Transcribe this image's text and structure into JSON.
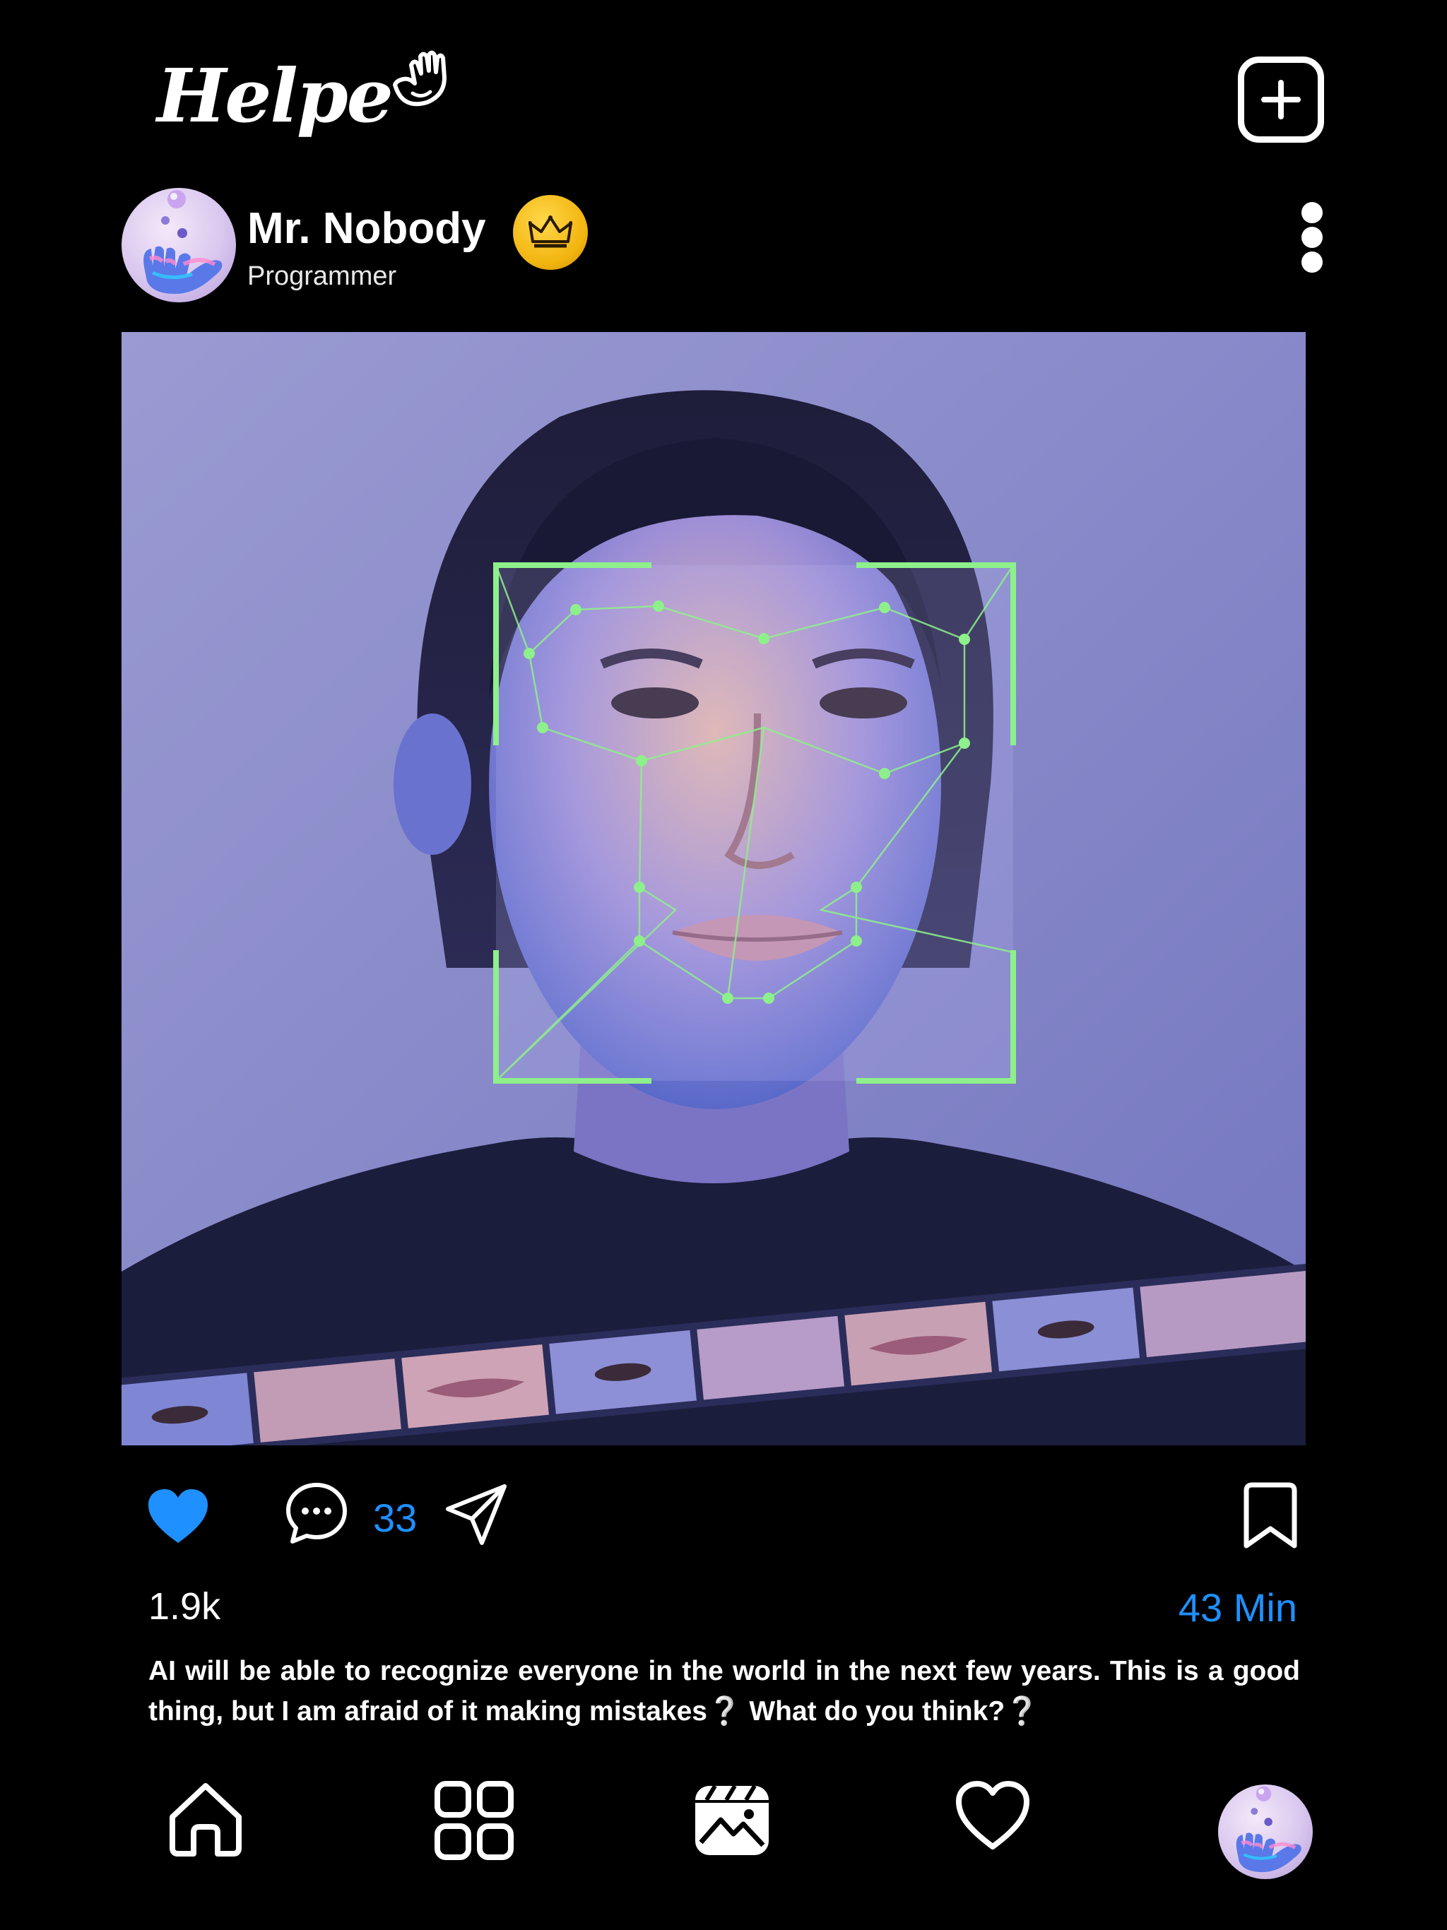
{
  "app": {
    "logo_text": "Helpe"
  },
  "post": {
    "author_name": "Mr. Nobody",
    "author_role": "Programmer",
    "comment_count": "33",
    "likes": "1.9k",
    "time_ago": "43 Min",
    "caption": "AI will be able to recognize everyone in the world in the next few years. This is a good thing, but I am afraid of it making mistakes❔ What do you think?❔",
    "liked": true
  },
  "colors": {
    "accent": "#1e90ff",
    "background": "#000000",
    "face_scan": "#8ef08a",
    "badge_gold": "#f2b40f"
  },
  "icons": {
    "new_post": "plus-square-icon",
    "more": "more-vertical-icon",
    "like": "heart-filled-icon",
    "comment": "chat-bubble-icon",
    "share": "paper-plane-icon",
    "bookmark": "bookmark-icon",
    "nav_home": "home-icon",
    "nav_grid": "grid-icon",
    "nav_reels": "clapperboard-icon",
    "nav_activity": "heart-outline-icon",
    "verified": "crown-icon"
  }
}
